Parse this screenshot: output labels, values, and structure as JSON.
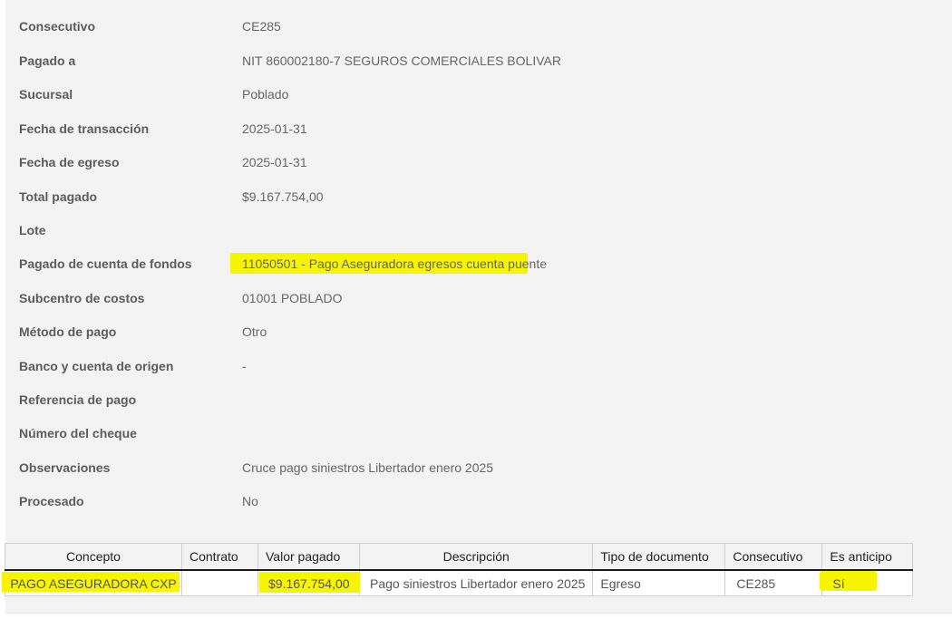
{
  "fields": [
    {
      "label": "Consecutivo",
      "value": "CE285"
    },
    {
      "label": "Pagado a",
      "value": "NIT 860002180-7 SEGUROS COMERCIALES BOLIVAR"
    },
    {
      "label": "Sucursal",
      "value": "Poblado"
    },
    {
      "label": "Fecha de transacción",
      "value": "2025-01-31"
    },
    {
      "label": "Fecha de egreso",
      "value": "2025-01-31"
    },
    {
      "label": "Total pagado",
      "value": "$9.167.754,00"
    },
    {
      "label": "Lote",
      "value": ""
    },
    {
      "label": "Pagado de cuenta de fondos",
      "value": "11050501 - Pago Aseguradora egresos cuenta puente"
    },
    {
      "label": "Subcentro de costos",
      "value": "01001 POBLADO"
    },
    {
      "label": "Método de pago",
      "value": "Otro"
    },
    {
      "label": "Banco y cuenta de origen",
      "value": "-"
    },
    {
      "label": "Referencia de pago",
      "value": ""
    },
    {
      "label": "Número del cheque",
      "value": ""
    },
    {
      "label": "Observaciones",
      "value": "Cruce pago siniestros Libertador enero 2025"
    },
    {
      "label": "Procesado",
      "value": "No"
    }
  ],
  "table": {
    "columns": [
      "Concepto",
      "Contrato",
      "Valor pagado",
      "Descripción",
      "Tipo de documento",
      "Consecutivo",
      "Es anticipo"
    ],
    "rows": [
      [
        "PAGO ASEGURADORA CXP",
        "",
        "$9.167.754,00",
        "Pago siniestros Libertador enero 2025",
        "Egreso",
        "CE285",
        "Sí"
      ]
    ]
  },
  "colors": {
    "highlight": "#f6f400",
    "panel_bg": "#f3f3f3",
    "label_text": "#5c5c5c",
    "value_text": "#666666"
  }
}
